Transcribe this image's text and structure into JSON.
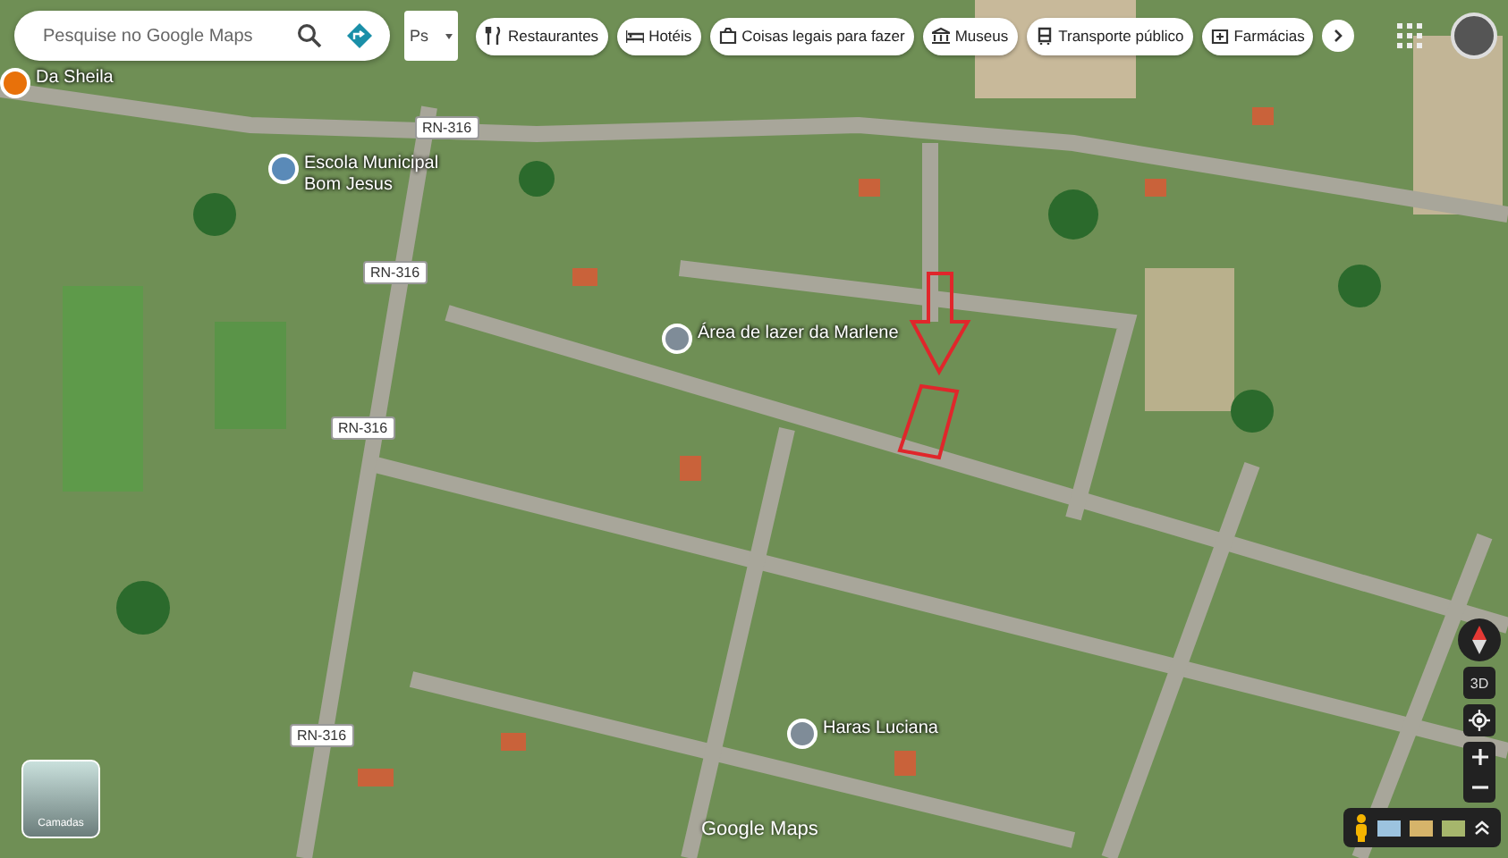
{
  "search": {
    "placeholder": "Pesquise no Google Maps"
  },
  "layer_menu": {
    "label": "Ps"
  },
  "chips": [
    {
      "label": "Restaurantes",
      "kind": "restaurant"
    },
    {
      "label": "Hotéis",
      "kind": "hotel"
    },
    {
      "label": "Coisas legais para fazer",
      "kind": "camera"
    },
    {
      "label": "Museus",
      "kind": "museum"
    },
    {
      "label": "Transporte público",
      "kind": "transit"
    },
    {
      "label": "Farmácias",
      "kind": "pharmacy"
    }
  ],
  "map_labels": [
    {
      "text": "Da Sheila",
      "kind": "pin",
      "color": "#e8710a"
    },
    {
      "text": "Escola Municipal Bom Jesus",
      "kind": "pin",
      "color": "#5a8ab8"
    },
    {
      "text": "RN-316",
      "kind": "road"
    },
    {
      "text": "RN-316",
      "kind": "road"
    },
    {
      "text": "RN-316",
      "kind": "road"
    },
    {
      "text": "RN-316",
      "kind": "road"
    },
    {
      "text": "Área de lazer da Marlene",
      "kind": "pin",
      "color": "#7f8c98"
    },
    {
      "text": "Haras Luciana",
      "kind": "pin",
      "color": "#7f8c98"
    }
  ],
  "controls": {
    "three_d": "3D"
  },
  "layers": {
    "label": "Camadas"
  },
  "logo": {
    "text": "Google Maps"
  }
}
